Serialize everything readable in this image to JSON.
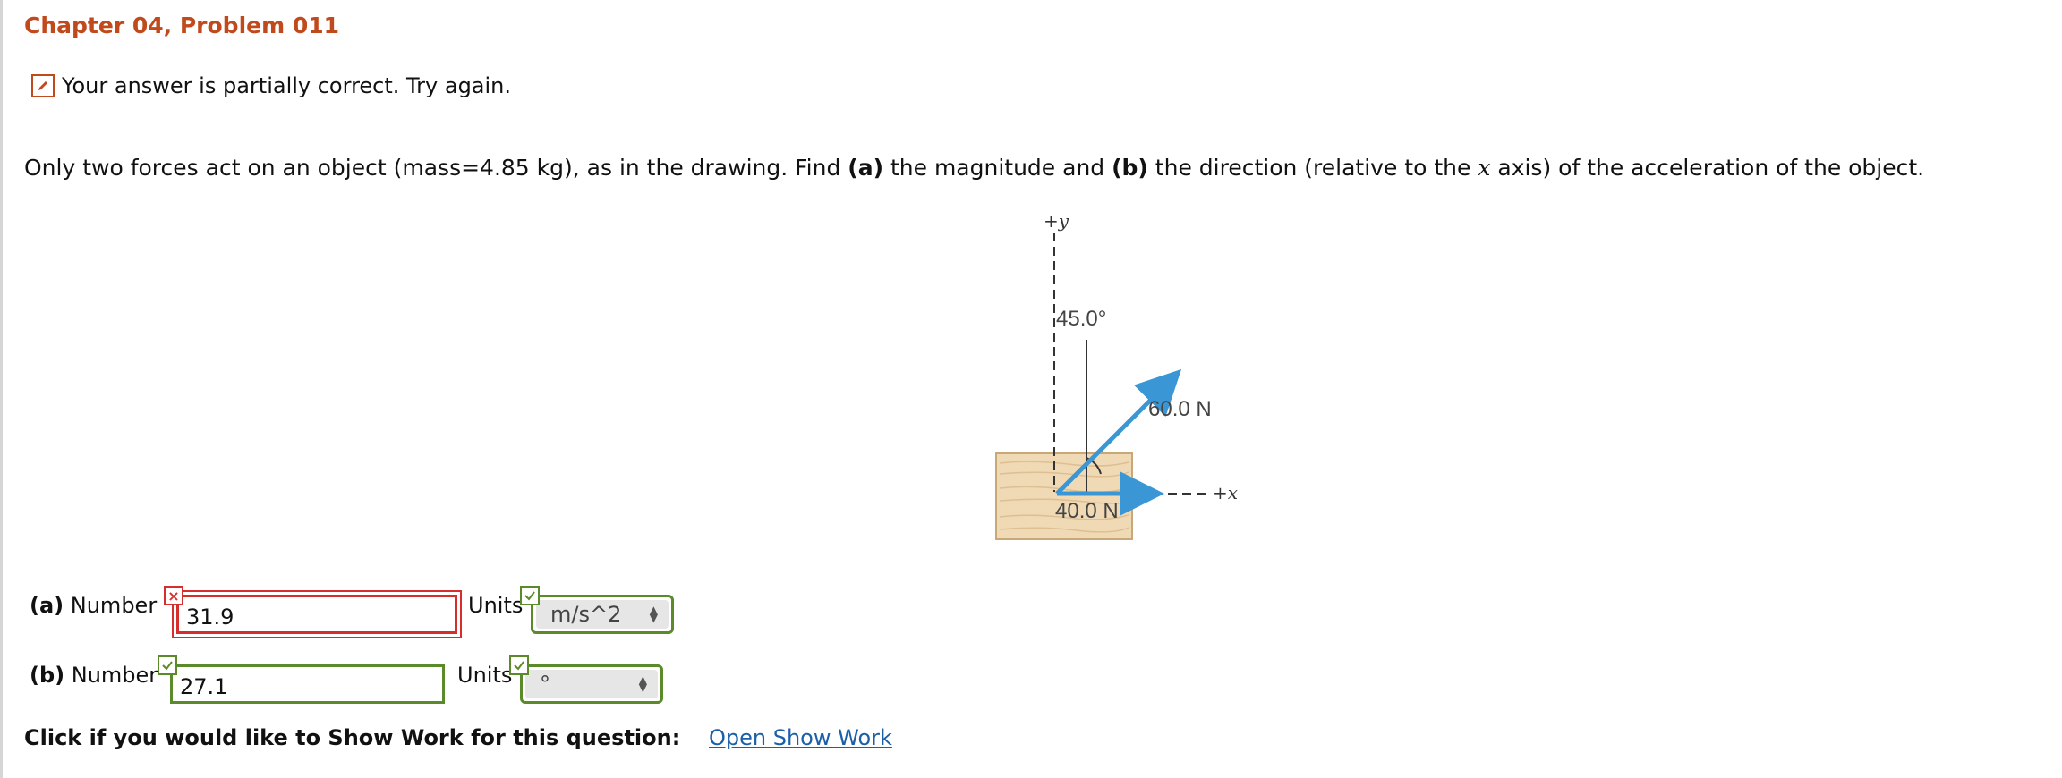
{
  "header": {
    "title": "Chapter 04, Problem 011"
  },
  "status": {
    "icon": "pencil-icon",
    "text": "Your answer is partially correct.  Try again."
  },
  "question": {
    "part1": "Only two forces act on an object (mass=4.85 kg), as in the drawing. Find ",
    "a_tag": "(a)",
    "part2": " the magnitude and ",
    "b_tag": "(b)",
    "part3": " the direction (relative to the ",
    "axis_var": "x",
    "part4": " axis) of the acceleration of the object."
  },
  "figure": {
    "y_axis_label": "+y",
    "x_axis_label": "+x",
    "angle_label": "45.0°",
    "force1_label": "60.0 N",
    "force2_label": "40.0 N",
    "arrow_color": "#3a96d4",
    "block_color": "#f0d9b5"
  },
  "answers": {
    "a": {
      "tag": "(a)",
      "label": " Number",
      "value": "31.9",
      "status": "incorrect",
      "units_label": "Units",
      "units_value": "m/s^2",
      "units_status": "correct"
    },
    "b": {
      "tag": "(b)",
      "label": " Number",
      "value": "27.1",
      "status": "correct",
      "units_label": "Units",
      "units_value": "°",
      "units_status": "correct"
    }
  },
  "show_work": {
    "prompt": "Click if you would like to Show Work for this question:",
    "link": "Open Show Work"
  },
  "colors": {
    "title": "#c14a1c",
    "wrong": "#d62d2d",
    "right": "#5a8a2a",
    "link": "#1a5fa8"
  }
}
